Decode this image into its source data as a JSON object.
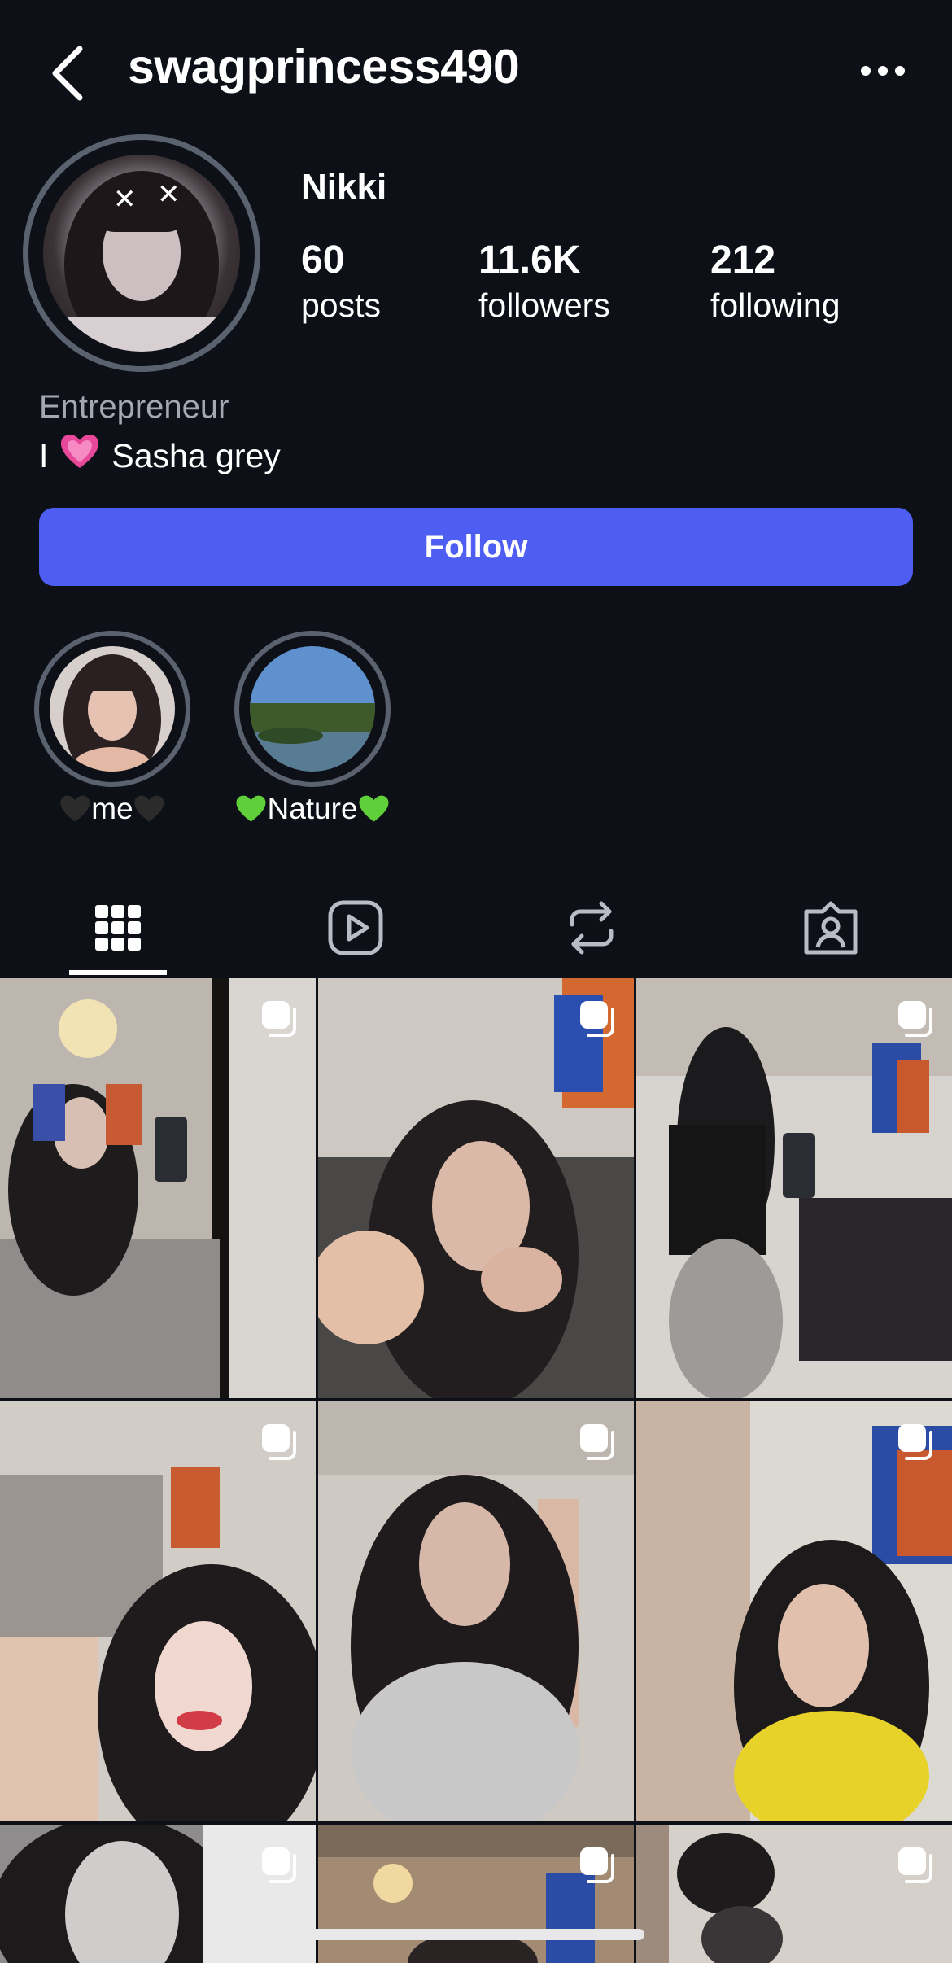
{
  "header": {
    "username": "swagprincess490",
    "back_icon": "chevron-left-icon",
    "more_icon": "ellipsis-icon"
  },
  "profile": {
    "display_name": "Nikki",
    "stats": [
      {
        "value": "60",
        "label": "posts"
      },
      {
        "value": "11.6K",
        "label": "followers"
      },
      {
        "value": "212",
        "label": "following"
      }
    ],
    "category": "Entrepreneur",
    "bio_before": "I",
    "bio_emoji": "pink-heart",
    "bio_after": "Sasha grey"
  },
  "follow_button": {
    "label": "Follow",
    "color": "#4e5ef2"
  },
  "highlights": [
    {
      "label": "me",
      "emoji": "black-heart"
    },
    {
      "label": "Nature",
      "emoji": "green-heart"
    }
  ],
  "tabs": [
    {
      "name": "posts-grid",
      "icon": "grid-icon",
      "active": true
    },
    {
      "name": "reels",
      "icon": "play-icon",
      "active": false
    },
    {
      "name": "reposts",
      "icon": "repost-icon",
      "active": false
    },
    {
      "name": "tagged",
      "icon": "tagged-person-icon",
      "active": false
    }
  ],
  "posts": [
    {
      "type": "video",
      "icon": "multi-post-icon"
    },
    {
      "type": "video",
      "icon": "multi-post-icon"
    },
    {
      "type": "video",
      "icon": "multi-post-icon"
    },
    {
      "type": "video",
      "icon": "multi-post-icon"
    },
    {
      "type": "video",
      "icon": "multi-post-icon"
    },
    {
      "type": "video",
      "icon": "multi-post-icon"
    },
    {
      "type": "video",
      "icon": "multi-post-icon"
    },
    {
      "type": "video",
      "icon": "multi-post-icon"
    },
    {
      "type": "video",
      "icon": "multi-post-icon"
    }
  ],
  "colors": {
    "background": "#0d1017",
    "secondary_text": "#a3a8b1",
    "ring": "#5a6270",
    "accent": "#4e5ef2"
  }
}
